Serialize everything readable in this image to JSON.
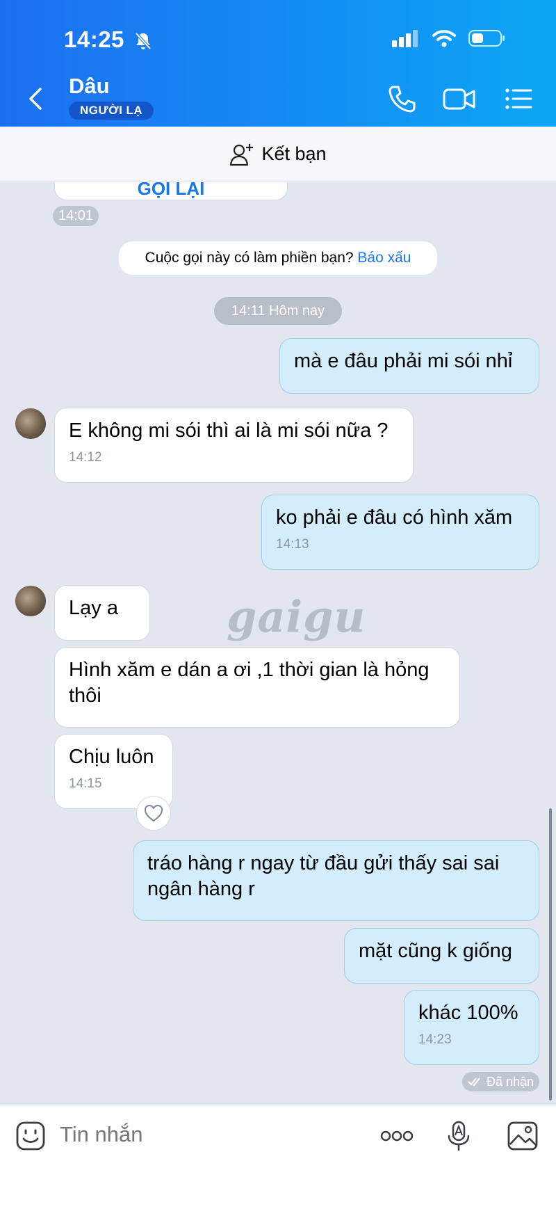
{
  "status": {
    "time": "14:25"
  },
  "header": {
    "title": "Dâu",
    "badge": "NGƯỜI LẠ"
  },
  "friend_bar": {
    "label": "Kết bạn"
  },
  "messages": {
    "call_back_label": "GỌI LẠI",
    "call_time": "14:01",
    "notice_text": "Cuộc gọi này có làm phiền bạn?",
    "notice_link": "Báo xấu",
    "date_divider": "14:11 Hôm nay",
    "m1": "mà e đâu phải mi sói nhỉ",
    "m2": "E không mi sói thì ai là mi sói nữa ?",
    "m2_time": "14:12",
    "m3": "ko phải e đâu có hình xăm",
    "m3_time": "14:13",
    "m4": "Lạy a",
    "m5_line1": "Hình xăm e dán a ơi ,1 thời gian là hỏng",
    "m5_line2": "thôi",
    "m6": "Chịu luôn",
    "m6_time": "14:15",
    "m7_line1": "tráo hàng r ngay từ đầu gửi thấy sai sai",
    "m7_line2": "ngân hàng r",
    "m8": "mặt cũng k giống",
    "m9": "khác 100%",
    "m9_time": "14:23",
    "received": "Đã nhận",
    "watermark": "gaigu"
  },
  "input": {
    "placeholder": "Tin nhắn"
  }
}
